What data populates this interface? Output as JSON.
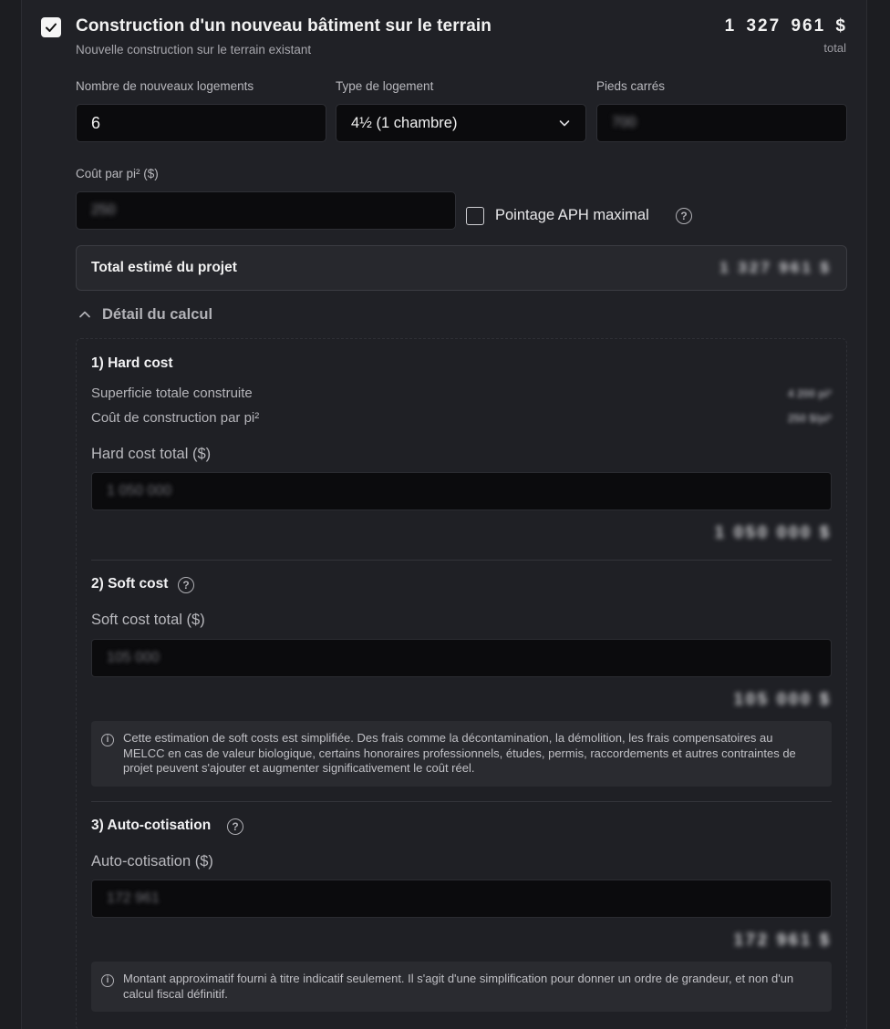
{
  "header": {
    "title": "Construction d'un nouveau bâtiment sur le terrain",
    "subtitle": "Nouvelle construction sur le terrain existant",
    "total_amount": "1 327 961 $",
    "total_label": "total",
    "checked": true
  },
  "fields": {
    "logements_label": "Nombre de nouveaux logements",
    "logements_value": "6",
    "type_label": "Type de logement",
    "type_value": "4½ (1 chambre)",
    "pieds_label": "Pieds carrés",
    "pieds_value": "700",
    "cout_label": "Coût par pi² ($)",
    "cout_value": "250",
    "aph_label": "Pointage APH maximal",
    "aph_checked": false
  },
  "total_estime": {
    "label": "Total estimé du projet",
    "value": "1 327 961 $"
  },
  "detail": {
    "toggle_label": "Détail du calcul",
    "hard_cost": {
      "title": "1) Hard cost",
      "superficie_label": "Superficie totale construite",
      "superficie_value": "4 200 pi²",
      "cout_label": "Coût de construction par pi²",
      "cout_value": "250 $/pi²",
      "total_label": "Hard cost total ($)",
      "input_value": "1 050 000",
      "total_value": "1 050 000 $"
    },
    "soft_cost": {
      "title": "2) Soft cost",
      "total_label": "Soft cost total ($)",
      "input_value": "105 000",
      "total_value": "105 000 $",
      "note": "Cette estimation de soft costs est simplifiée. Des frais comme la décontamination, la démolition, les frais compensatoires au MELCC en cas de valeur biologique, certains honoraires professionnels, études, permis, raccordements et autres contraintes de projet peuvent s'ajouter et augmenter significativement le coût réel."
    },
    "auto_cotisation": {
      "title": "3) Auto-cotisation",
      "total_label": "Auto-cotisation ($)",
      "input_value": "172 961",
      "total_value": "172 961 $",
      "note": "Montant approximatif fourni à titre indicatif seulement. Il s'agit d'une simplification pour donner un ordre de grandeur, et non d'un calcul fiscal définitif."
    }
  },
  "icons": {
    "check": "check-icon",
    "chevron_down": "chevron-down-icon",
    "chevron_up": "chevron-up-icon",
    "help": "help-circle-icon",
    "info": "info-icon"
  }
}
